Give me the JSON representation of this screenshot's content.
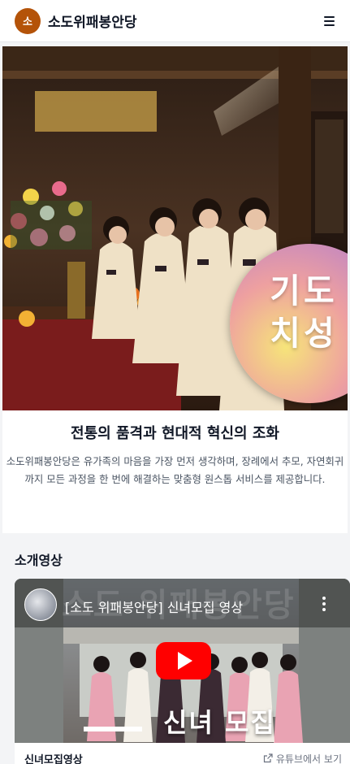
{
  "header": {
    "logo_text": "소",
    "brand": "소도위패봉안당",
    "menu_icon": "hamburger-menu-icon"
  },
  "hero": {
    "badge_text": "기도 치성",
    "colors": {
      "badge_gradient_start": "#f6e47a",
      "badge_gradient_end": "#b07ccf"
    }
  },
  "intro": {
    "title": "전통의 품격과 현대적 혁신의 조화",
    "description": "소도위패봉안당은 유가족의 마음을 가장 먼저 생각하며, 장례에서 추모, 자연회귀까지 모든 과정을 한 번에 해결하는 맞춤형 원스톱 서비스를 제공합니다."
  },
  "video_section": {
    "title": "소개영상",
    "video": {
      "title": "[소도 위패봉안당] 신녀모집 영상",
      "watermark": "소도 위패봉안당",
      "caption": "신녀 모집",
      "name": "신녀모집영상",
      "youtube_link": "유튜브에서 보기",
      "icons": [
        "channel-avatar",
        "kebab-menu-icon",
        "play-icon",
        "external-link-icon"
      ]
    }
  },
  "colors": {
    "accent": "#b45309",
    "play_button": "#ff0000"
  }
}
